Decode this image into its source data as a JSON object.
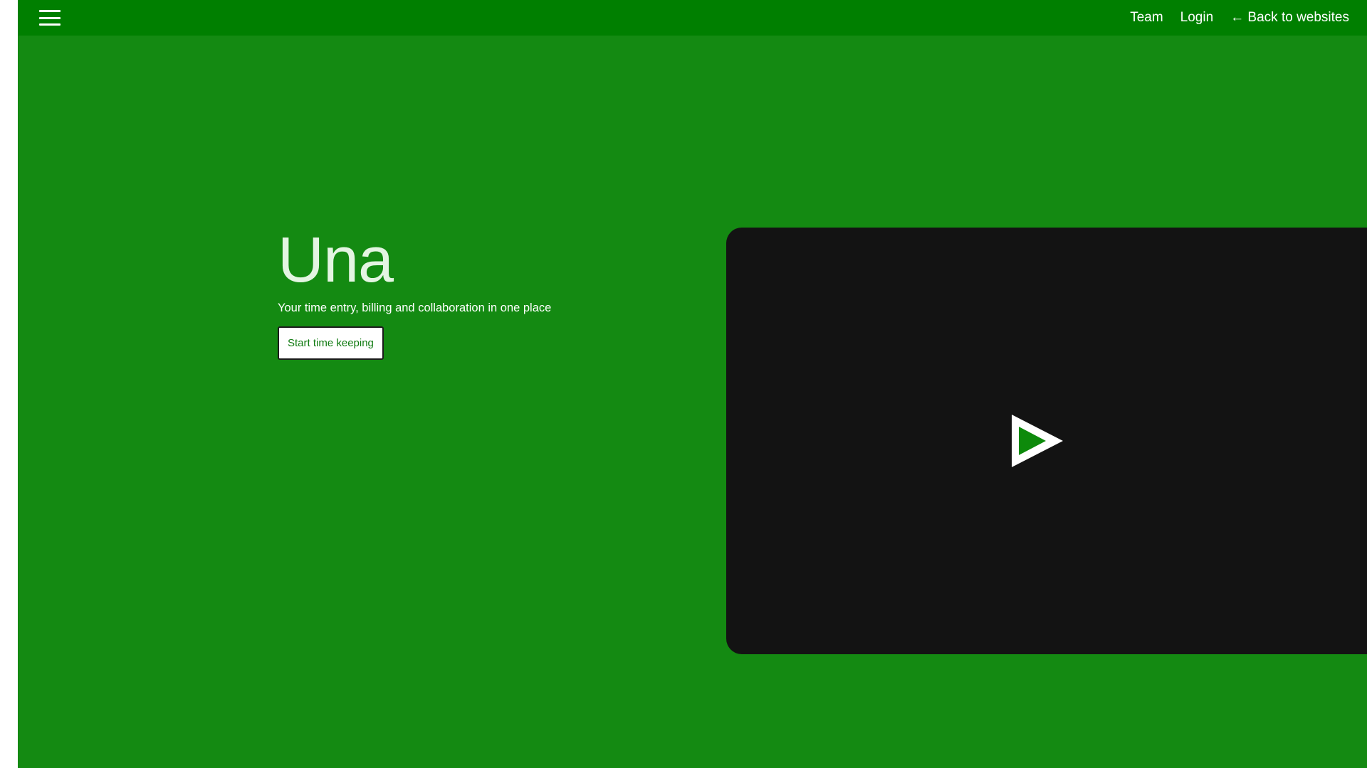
{
  "nav": {
    "menu_icon": "hamburger-menu-icon",
    "team_label": "Team",
    "login_label": "Login",
    "back_label": "← Back to websites"
  },
  "hero": {
    "title": "Una",
    "subtitle": "Your time entry, billing and collaboration in one place",
    "cta_label": "Start time keeping"
  },
  "video": {
    "play_icon": "play-icon"
  },
  "colors": {
    "background": "#148a12",
    "topbar": "#007f00",
    "video_background": "#131313",
    "cta_text": "#0f7a10",
    "title_text": "#e4f5e2",
    "play_fill": "#0d8a0b"
  }
}
